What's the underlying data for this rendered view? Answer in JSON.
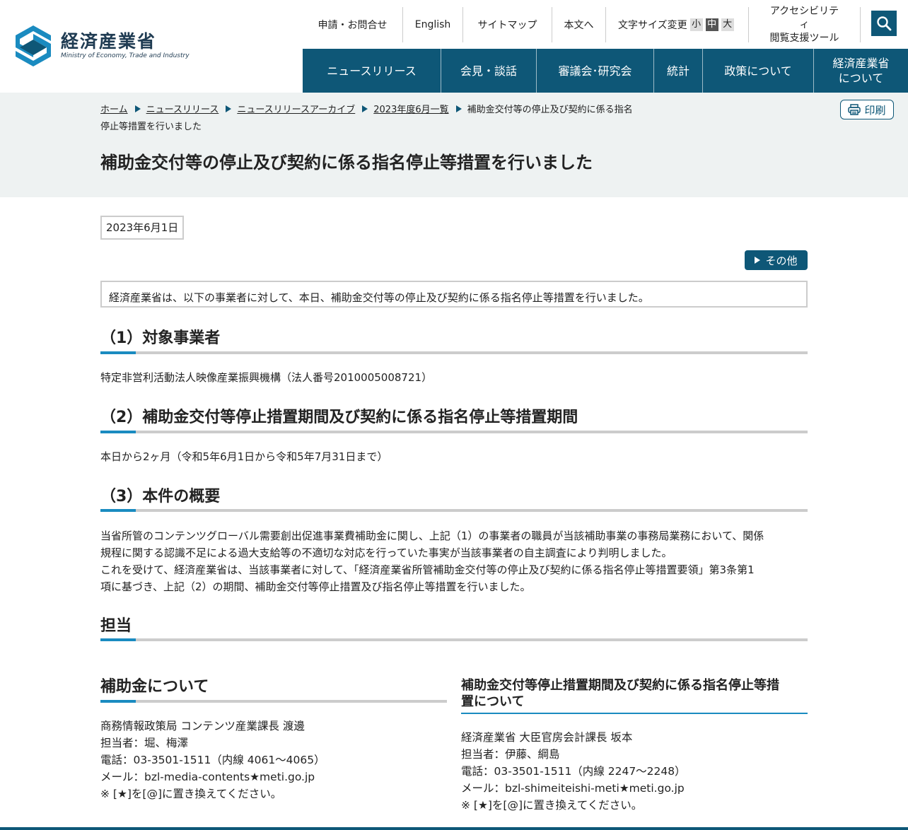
{
  "header": {
    "logo_jp": "経済産業省",
    "logo_en": "Ministry of Economy, Trade and Industry",
    "utility": {
      "contact": "申請・お問合せ",
      "english": "English",
      "sitemap": "サイトマップ",
      "to_content": "本文へ",
      "font_size_label": "文字サイズ変更",
      "font_small": "小",
      "font_medium": "中",
      "font_large": "大",
      "accessibility_line1": "アクセシビリティ",
      "accessibility_line2": "閲覧支援ツール"
    },
    "search_icon": "search-icon",
    "nav": [
      {
        "label": "ニュースリリース"
      },
      {
        "label": "会見・談話"
      },
      {
        "label": "審議会･研究会"
      },
      {
        "label": "統計"
      },
      {
        "label": "政策について"
      },
      {
        "label_line1": "経済産業省",
        "label_line2": "について"
      }
    ]
  },
  "breadcrumb": {
    "items": [
      "ホーム",
      "ニュースリリース",
      "ニュースリリースアーカイブ",
      "2023年度6月一覧"
    ],
    "current_line1": "補助金交付等の停止及び契約に係る指名",
    "current_line2": "停止等措置を行いました"
  },
  "print_label": "印刷",
  "page_title": "補助金交付等の停止及び契約に係る指名停止等措置を行いました",
  "date": "2023年6月1日",
  "other_label": "その他",
  "lead": "経済産業省は、以下の事業者に対して、本日、補助金交付等の停止及び契約に係る指名停止等措置を行いました。",
  "sections": [
    {
      "heading": "（1）対象事業者",
      "body": "特定非営利活動法人映像産業振興機構（法人番号2010005008721）"
    },
    {
      "heading": "（2）補助金交付等停止措置期間及び契約に係る指名停止等措置期間",
      "body": "本日から2ヶ月（令和5年6月1日から令和5年7月31日まで）"
    },
    {
      "heading": "（3）本件の概要",
      "body_line1": "当省所管のコンテンツグローバル需要創出促進事業費補助金に関し、上記（1）の事業者の職員が当該補助事業の事務局業務において、関係",
      "body_line2": "規程に関する認識不足による過大支給等の不適切な対応を行っていた事実が当該事業者の自主調査により判明しました。",
      "body_line3": "これを受けて、経済産業省は、当該事業者に対して、「経済産業省所管補助金交付等の停止及び契約に係る指名停止等措置要領」第3条第1",
      "body_line4": "項に基づき、上記（2）の期間、補助金交付等停止措置及び指名停止等措置を行いました。"
    }
  ],
  "contact_heading": "担当",
  "contacts": [
    {
      "heading": "補助金について",
      "lines": [
        "商務情報政策局 コンテンツ産業課長 渡邊",
        "担当者：堀、梅澤",
        "電話：03-3501-1511（内線 4061～4065）",
        "メール：bzl-media-contents★meti.go.jp",
        "※ [★]を[@]に置き換えてください。"
      ]
    },
    {
      "heading_line1": "補助金交付等停止措置期間及び契約に係る指名停止等措",
      "heading_line2": "置について",
      "lines": [
        "経済産業省 大臣官房会計課長 坂本",
        "担当者：伊藤、綱島",
        "電話：03-3501-1511（内線 2247～2248）",
        "メール：bzl-shimeiteishi-meti★meti.go.jp",
        "※ [★]を[@]に置き換えてください。"
      ]
    }
  ],
  "colors": {
    "brand": "#0e5777",
    "accent": "#1a8bc0",
    "band": "#eef2f2"
  }
}
